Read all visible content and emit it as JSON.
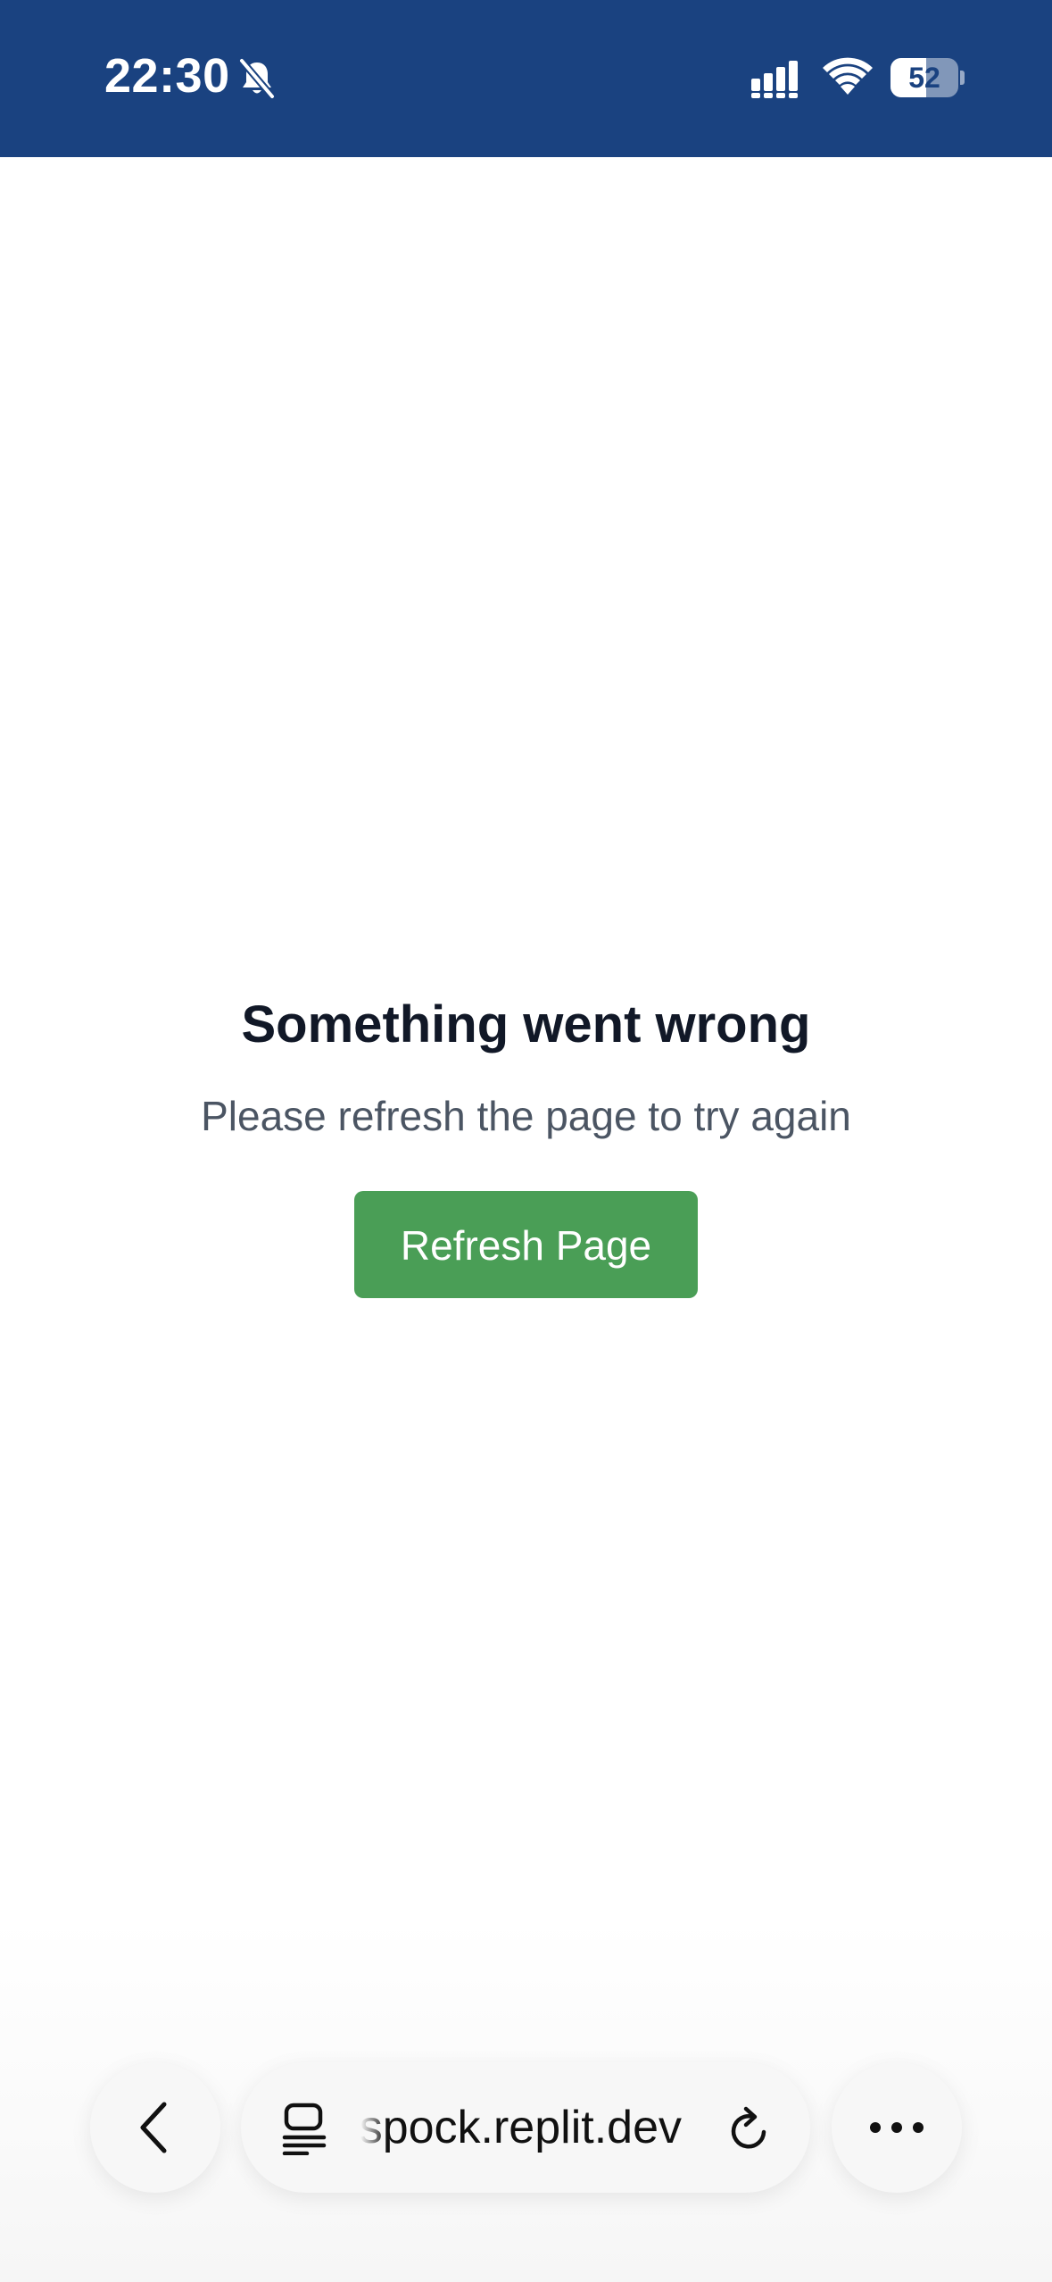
{
  "status_bar": {
    "time": "22:30",
    "battery_level": "52",
    "battery_fraction": 0.52,
    "icons": [
      "bell-slash-icon",
      "cellular-signal-icon",
      "wifi-icon",
      "battery-icon"
    ],
    "background_color": "#1a4280"
  },
  "error": {
    "title": "Something went wrong",
    "message": "Please refresh the page to try again",
    "button_label": "Refresh Page",
    "button_color": "#4a9e56"
  },
  "browser_bar": {
    "url": "spock.replit.dev",
    "icons": [
      "back-chevron-icon",
      "tab-list-icon",
      "reload-icon",
      "more-icon"
    ]
  }
}
